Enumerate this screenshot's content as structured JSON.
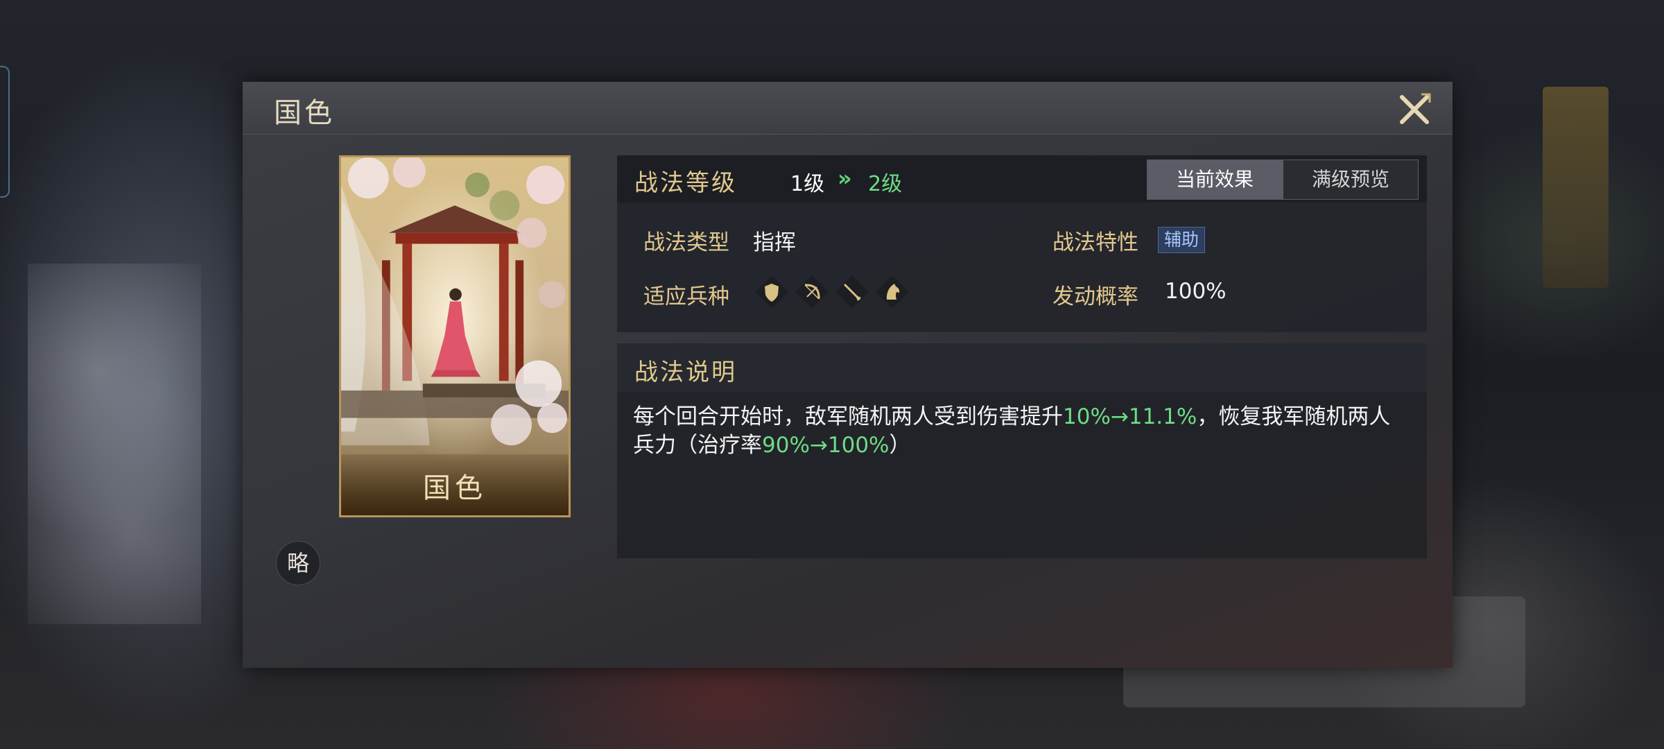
{
  "modal": {
    "title": "国色",
    "close_icon": "close-x-icon"
  },
  "card": {
    "name": "国色",
    "art": "lady-in-red-under-blossoms",
    "tag": "略"
  },
  "level": {
    "title": "战法等级",
    "from": "1级",
    "arrow": "»",
    "to": "2级"
  },
  "tabs": [
    {
      "label": "当前效果",
      "active": true
    },
    {
      "label": "满级预览",
      "active": false
    }
  ],
  "attributes": {
    "type_label": "战法类型",
    "type_value": "指挥",
    "trait_label": "战法特性",
    "trait_value": "辅助",
    "troops_label": "适应兵种",
    "troop_icons": [
      "shield-icon",
      "bow-icon",
      "spear-icon",
      "horse-icon"
    ],
    "chance_label": "发动概率",
    "chance_value": "100%"
  },
  "description": {
    "title": "战法说明",
    "seg1": "每个回合开始时，敌军随机两人受到伤害提升",
    "hl1": "10%→11.1%",
    "seg2": "，恢复我军随机两人兵力（治疗率",
    "hl2": "90%→100%",
    "seg3": "）"
  },
  "colors": {
    "gold": "#e0c98c",
    "green": "#6fdc86",
    "badge_blue": "#a8c6ff"
  }
}
